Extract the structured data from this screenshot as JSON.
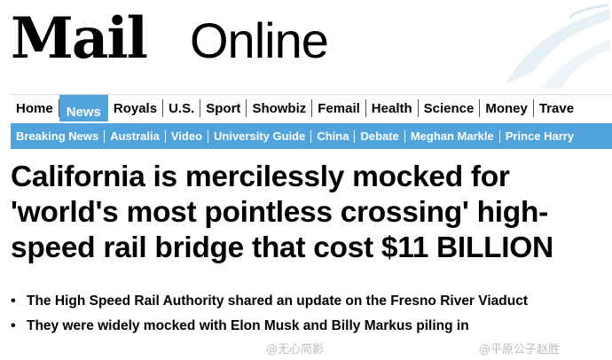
{
  "masthead": {
    "logo_mail": "Mail",
    "logo_online": "Online"
  },
  "nav": {
    "items": [
      {
        "label": "Home",
        "active": false
      },
      {
        "label": "News",
        "active": true
      },
      {
        "label": "Royals",
        "active": false
      },
      {
        "label": "U.S.",
        "active": false
      },
      {
        "label": "Sport",
        "active": false
      },
      {
        "label": "Showbiz",
        "active": false
      },
      {
        "label": "Femail",
        "active": false
      },
      {
        "label": "Health",
        "active": false
      },
      {
        "label": "Science",
        "active": false
      },
      {
        "label": "Money",
        "active": false
      },
      {
        "label": "Trave",
        "active": false
      }
    ]
  },
  "subnav": {
    "items": [
      {
        "label": "Breaking News"
      },
      {
        "label": "Australia"
      },
      {
        "label": "Video"
      },
      {
        "label": "University Guide"
      },
      {
        "label": "China"
      },
      {
        "label": "Debate"
      },
      {
        "label": "Meghan Markle"
      },
      {
        "label": "Prince Harry"
      }
    ]
  },
  "article": {
    "headline": "California is mercilessly mocked for 'world's most pointless crossing' high-speed rail bridge that cost $11 BILLION",
    "bullets": [
      {
        "text": "The High Speed Rail Authority shared an update on the Fresno River Viaduct"
      },
      {
        "text": "They were widely mocked with Elon Musk and Billy Markus piling in"
      }
    ]
  },
  "watermarks": {
    "left": "@无心简影",
    "right": "@平原公子赵胜"
  },
  "colors": {
    "accent": "#51a3dd",
    "text": "#000000"
  }
}
